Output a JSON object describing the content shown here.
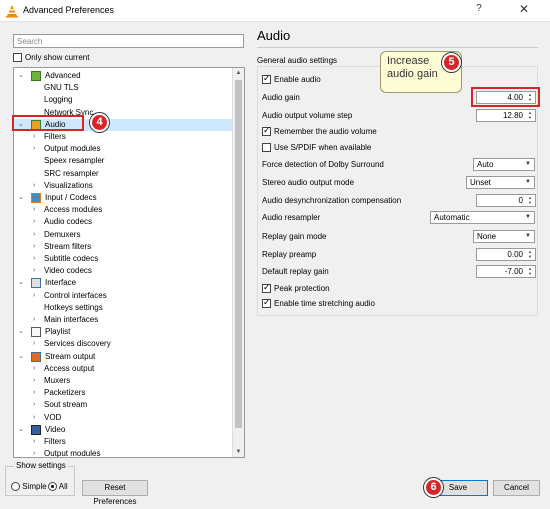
{
  "window": {
    "title": "Advanced Preferences",
    "help_glyph": "?",
    "close_glyph": "✕"
  },
  "sidebar": {
    "search_placeholder": "Search",
    "only_show_current": "Only show current",
    "tree": [
      {
        "label": "Advanced",
        "level": 0,
        "expanded": true,
        "icon": "advanced-icon"
      },
      {
        "label": "GNU TLS",
        "level": 1
      },
      {
        "label": "Logging",
        "level": 1
      },
      {
        "label": "Network Sync",
        "level": 1
      },
      {
        "label": "Audio",
        "level": 0,
        "expanded": true,
        "icon": "audio-icon",
        "selected": true
      },
      {
        "label": "Filters",
        "level": 1,
        "has_children": true
      },
      {
        "label": "Output modules",
        "level": 1,
        "has_children": true
      },
      {
        "label": "Speex resampler",
        "level": 1
      },
      {
        "label": "SRC resampler",
        "level": 1
      },
      {
        "label": "Visualizations",
        "level": 1,
        "has_children": true
      },
      {
        "label": "Input / Codecs",
        "level": 0,
        "expanded": true,
        "icon": "input-codecs-icon"
      },
      {
        "label": "Access modules",
        "level": 1,
        "has_children": true
      },
      {
        "label": "Audio codecs",
        "level": 1,
        "has_children": true
      },
      {
        "label": "Demuxers",
        "level": 1,
        "has_children": true
      },
      {
        "label": "Stream filters",
        "level": 1,
        "has_children": true
      },
      {
        "label": "Subtitle codecs",
        "level": 1,
        "has_children": true
      },
      {
        "label": "Video codecs",
        "level": 1,
        "has_children": true
      },
      {
        "label": "Interface",
        "level": 0,
        "expanded": true,
        "icon": "interface-icon"
      },
      {
        "label": "Control interfaces",
        "level": 1,
        "has_children": true
      },
      {
        "label": "Hotkeys settings",
        "level": 1
      },
      {
        "label": "Main interfaces",
        "level": 1,
        "has_children": true
      },
      {
        "label": "Playlist",
        "level": 0,
        "expanded": true,
        "icon": "playlist-icon"
      },
      {
        "label": "Services discovery",
        "level": 1,
        "has_children": true
      },
      {
        "label": "Stream output",
        "level": 0,
        "expanded": true,
        "icon": "stream-output-icon"
      },
      {
        "label": "Access output",
        "level": 1,
        "has_children": true
      },
      {
        "label": "Muxers",
        "level": 1,
        "has_children": true
      },
      {
        "label": "Packetizers",
        "level": 1,
        "has_children": true
      },
      {
        "label": "Sout stream",
        "level": 1,
        "has_children": true
      },
      {
        "label": "VOD",
        "level": 1,
        "has_children": true
      },
      {
        "label": "Video",
        "level": 0,
        "expanded": true,
        "icon": "video-icon"
      },
      {
        "label": "Filters",
        "level": 1,
        "has_children": true
      },
      {
        "label": "Output modules",
        "level": 1,
        "has_children": true
      }
    ]
  },
  "show_settings": {
    "legend": "Show settings",
    "simple": "Simple",
    "all": "All",
    "selected": "All"
  },
  "buttons": {
    "reset": "Reset Preferences",
    "save": "Save",
    "cancel": "Cancel"
  },
  "panel": {
    "title": "Audio",
    "group_title": "General audio settings",
    "enable_audio": "Enable audio",
    "audio_gain_label": "Audio gain",
    "audio_gain_value": "4.00",
    "volume_step_label": "Audio output volume step",
    "volume_step_value": "12.80",
    "remember_volume": "Remember the audio volume",
    "use_spdif": "Use S/PDIF when available",
    "dolby_label": "Force detection of Dolby Surround",
    "dolby_value": "Auto",
    "stereo_label": "Stereo audio output mode",
    "stereo_value": "Unset",
    "desync_label": "Audio desynchronization compensation",
    "desync_value": "0",
    "resampler_label": "Audio resampler",
    "resampler_value": "Automatic",
    "replay_mode_label": "Replay gain mode",
    "replay_mode_value": "None",
    "replay_preamp_label": "Replay preamp",
    "replay_preamp_value": "0.00",
    "default_replay_label": "Default replay gain",
    "default_replay_value": "-7.00",
    "peak_protection": "Peak protection",
    "time_stretching": "Enable time stretching audio"
  },
  "annotations": {
    "callout_4": "4",
    "callout_5": "5",
    "callout_6": "6",
    "tooltip_text": "Increase audio gain",
    "highlight_color": "#d9242a"
  }
}
